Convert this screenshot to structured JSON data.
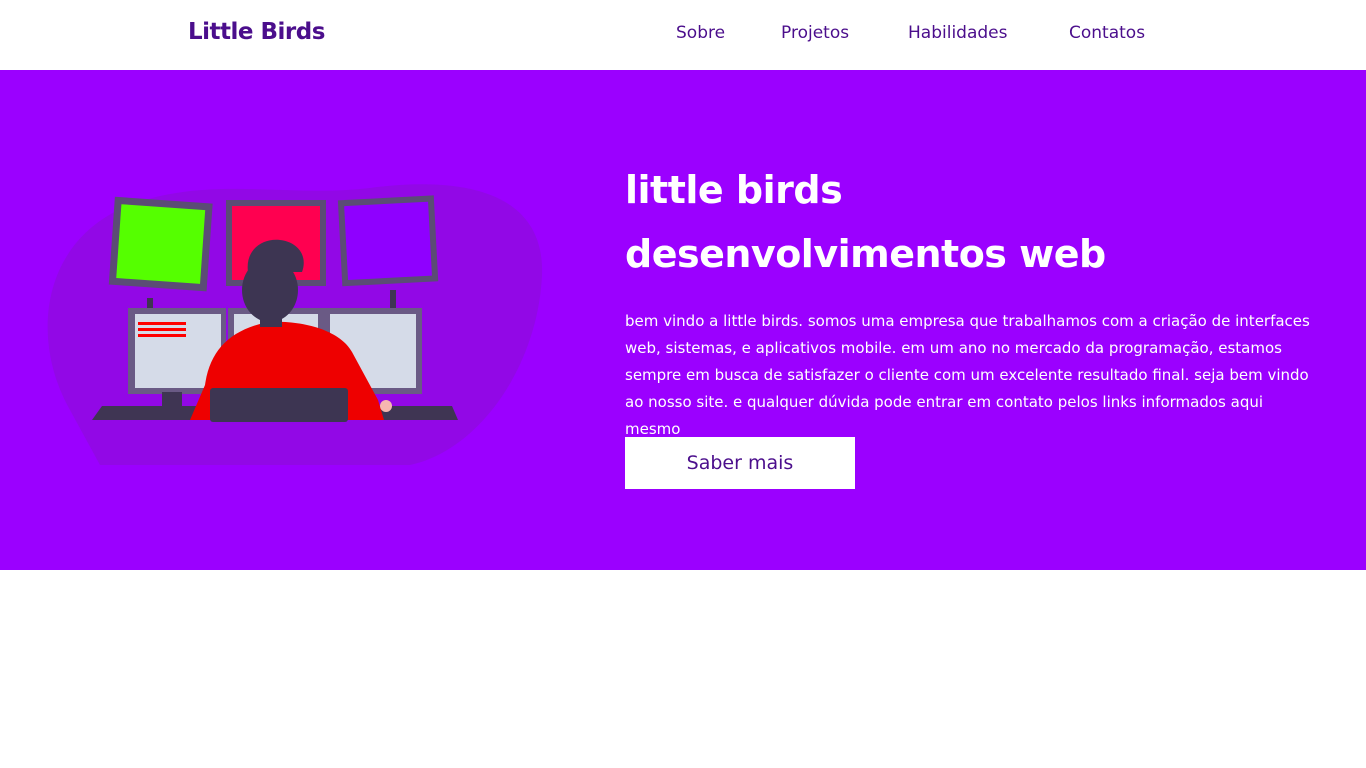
{
  "nav": {
    "brand": "Little Birds",
    "links": [
      {
        "label": "Sobre"
      },
      {
        "label": "Projetos"
      },
      {
        "label": "Habilidades"
      },
      {
        "label": "Contatos"
      }
    ]
  },
  "hero": {
    "title_line1": "little birds",
    "title_line2": "desenvolvimentos web",
    "description": "bem vindo a little birds. somos uma empresa que trabalhamos com a criação de interfaces web, sistemas, e aplicativos mobile. em um ano no mercado da programação, estamos sempre em busca de satisfazer o cliente com um excelente resultado final. seja bem vindo ao nosso site. e qualquer dúvida pode entrar em contato pelos links informados aqui mesmo",
    "cta_label": "Saber mais",
    "illustration": "developer-at-monitors-illustration"
  },
  "colors": {
    "brand_purple": "#4b0e8c",
    "hero_background": "#9b00ff",
    "white": "#ffffff"
  }
}
